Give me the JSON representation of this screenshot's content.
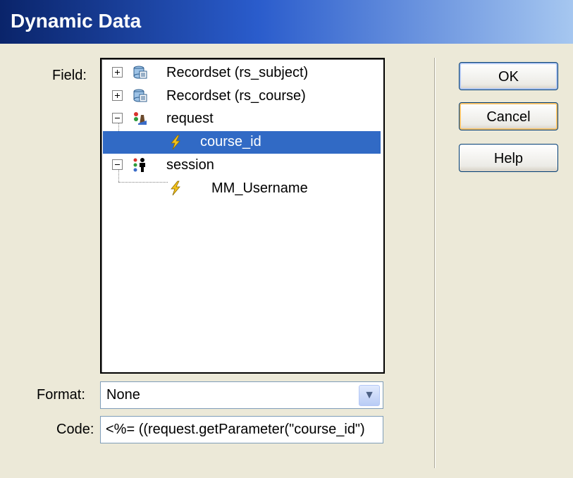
{
  "window": {
    "title": "Dynamic Data"
  },
  "field": {
    "label": "Field:"
  },
  "tree": [
    {
      "label": "Recordset (rs_subject)",
      "icon": "recordset-icon",
      "expander": "+"
    },
    {
      "label": "Recordset (rs_course)",
      "icon": "recordset-icon",
      "expander": "+"
    },
    {
      "label": "request",
      "icon": "request-icon",
      "expander": "-"
    },
    {
      "label": "course_id",
      "icon": "lightning-icon",
      "selected": true
    },
    {
      "label": "session",
      "icon": "session-icon",
      "expander": "-"
    },
    {
      "label": "MM_Username",
      "icon": "lightning-icon"
    }
  ],
  "format": {
    "label": "Format:",
    "value": "None"
  },
  "code": {
    "label": "Code:",
    "value": "<%= ((request.getParameter(\"course_id\")"
  },
  "buttons": {
    "ok": "OK",
    "cancel": "Cancel",
    "help": "Help"
  },
  "colors": {
    "selection": "#316ac5",
    "dialog_bg": "#ece9d8"
  }
}
